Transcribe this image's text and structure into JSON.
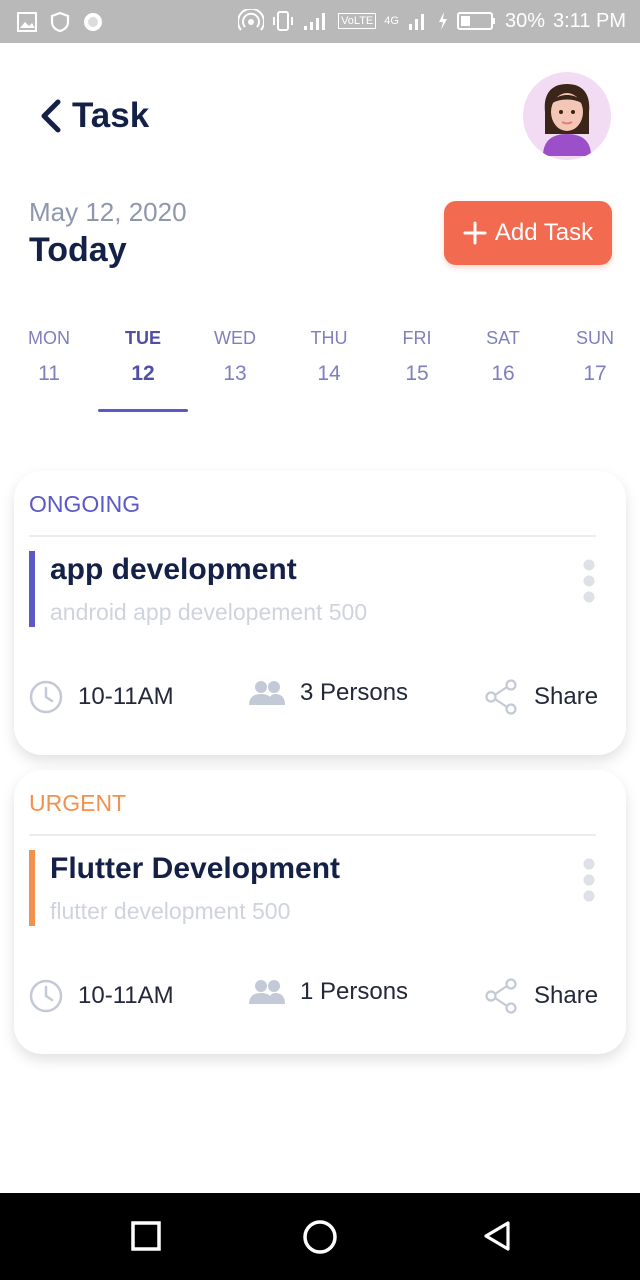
{
  "status_bar": {
    "battery_text": "30%",
    "time_text": "3:11 PM",
    "volte_label": "VoLTE",
    "network_label": "4G"
  },
  "header": {
    "title": "Task",
    "date": "May 12, 2020",
    "today_label": "Today",
    "add_button_label": "Add Task"
  },
  "week": [
    {
      "day": "MON",
      "date": "11"
    },
    {
      "day": "TUE",
      "date": "12"
    },
    {
      "day": "WED",
      "date": "13"
    },
    {
      "day": "THU",
      "date": "14"
    },
    {
      "day": "FRI",
      "date": "15"
    },
    {
      "day": "SAT",
      "date": "16"
    },
    {
      "day": "SUN",
      "date": "17"
    }
  ],
  "selected_day": "TUE",
  "tasks": [
    {
      "status": "ONGOING",
      "status_color": "#5b59c7",
      "title": "app development",
      "subtitle": "android app developement 500",
      "time": "10-11AM",
      "persons": "3 Persons",
      "share_label": "Share"
    },
    {
      "status": "URGENT",
      "status_color": "#f2904f",
      "title": "Flutter Development",
      "subtitle": "flutter development 500",
      "time": "10-11AM",
      "persons": "1 Persons",
      "share_label": "Share"
    }
  ],
  "icons": [
    "image-icon",
    "shield-icon",
    "circle-icon",
    "hotspot-icon",
    "vibrate-icon",
    "signal-icon",
    "battery-icon",
    "back-arrow-icon",
    "avatar",
    "plus-icon",
    "more-vert-icon",
    "clock-icon",
    "people-icon",
    "share-icon",
    "nav-recents-icon",
    "nav-home-icon",
    "nav-back-icon"
  ],
  "colors": {
    "accent": "#f26a4f",
    "primary_text": "#152047",
    "week_text": "#7e7fbf",
    "selected_underline": "#5b59c7"
  }
}
